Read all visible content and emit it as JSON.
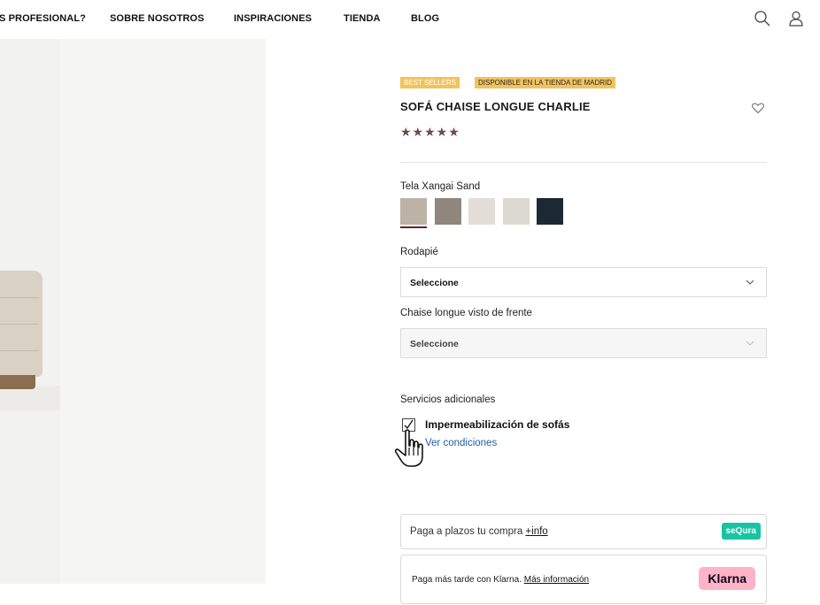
{
  "nav": {
    "items": [
      "S PROFESIONAL?",
      "SOBRE NOSOTROS",
      "INSPIRACIONES",
      "TIENDA",
      "BLOG"
    ],
    "icons": [
      "search-icon",
      "user-icon"
    ]
  },
  "product": {
    "badges": [
      "BEST SELLERS",
      "DISPONIBLE EN LA TIENDA DE MADRID"
    ],
    "title": "SOFÁ CHAISE LONGUE CHARLIE",
    "stars": "★★★★★",
    "rating_value": 5,
    "favorite_icon": "heart-icon"
  },
  "fabric": {
    "label": "Tela Xangai Sand",
    "swatches": [
      {
        "color": "#bdb2a6",
        "selected": true
      },
      {
        "color": "#8f877c",
        "selected": false
      },
      {
        "color": "#e2ddd6",
        "selected": false
      },
      {
        "color": "#dcdad0",
        "selected": false
      },
      {
        "color": "#1c2832",
        "selected": false
      }
    ]
  },
  "options": {
    "rodapie_label": "Rodapié",
    "rodapie_value": "Seleccione",
    "chaise_label": "Chaise longue visto de frente",
    "chaise_value": "Seleccione"
  },
  "services": {
    "label": "Servicios adicionales",
    "checkbox_label": "Impermeabilización de sofás",
    "checked": true,
    "conditions_link": "Ver condiciones"
  },
  "financing": {
    "sequra_text": "Paga a plazos tu compra ",
    "sequra_link": "+info",
    "sequra_logo": "seQura",
    "klarna_text": "Paga más tarde con Klarna. ",
    "klarna_link": "Más información",
    "klarna_logo": "Klarna"
  },
  "colors": {
    "badge": "#f3c35b",
    "stars": "#6e4b4b",
    "link": "#1f5fa8",
    "sequra": "#17c5a2",
    "klarna": "#ffb3c7",
    "swatch_selected_underline": "#6b1f2a"
  }
}
